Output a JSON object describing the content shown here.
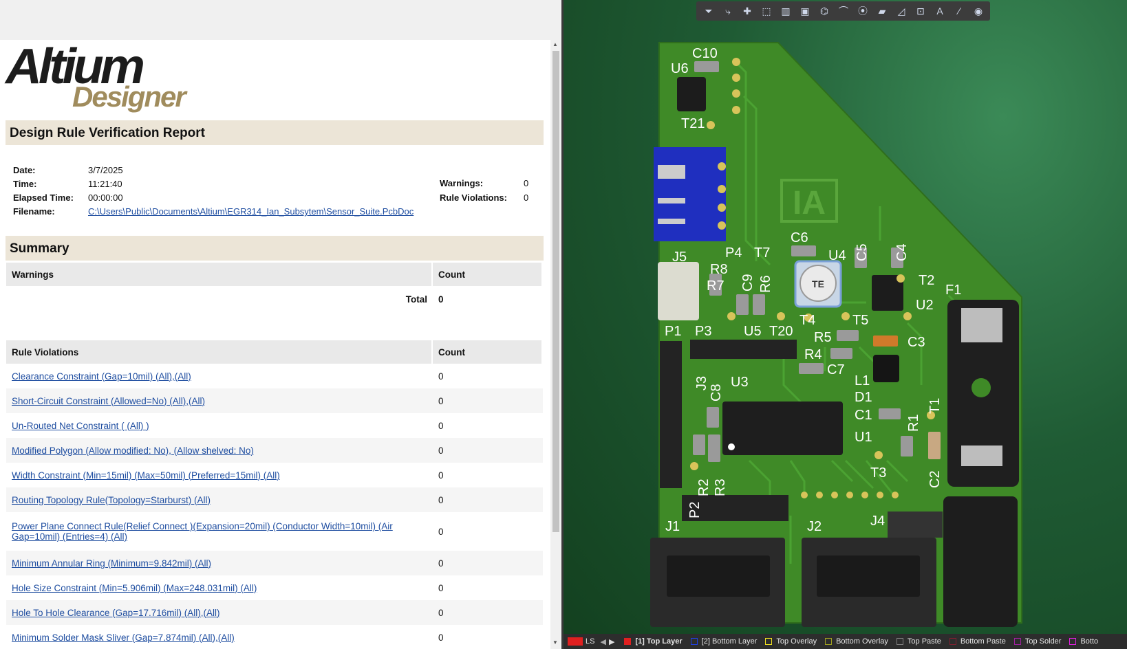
{
  "report": {
    "logo": {
      "primary": "Altium",
      "secondary": "Designer"
    },
    "title": "Design Rule Verification Report",
    "meta": {
      "date_label": "Date:",
      "date": "3/7/2025",
      "time_label": "Time:",
      "time": "11:21:40",
      "elapsed_label": "Elapsed Time:",
      "elapsed": "00:00:00",
      "filename_label": "Filename:",
      "filename": "C:\\Users\\Public\\Documents\\Altium\\EGR314_Ian_Subsytem\\Sensor_Suite.PcbDoc",
      "warnings_label": "Warnings:",
      "warnings": "0",
      "violations_label": "Rule Violations:",
      "violations": "0"
    },
    "summary_title": "Summary",
    "warnings_table": {
      "col1": "Warnings",
      "col2": "Count",
      "total_label": "Total",
      "total": "0"
    },
    "rules_table": {
      "col1": "Rule Violations",
      "col2": "Count",
      "rows": [
        {
          "name": "Clearance Constraint (Gap=10mil) (All),(All)",
          "count": "0"
        },
        {
          "name": "Short-Circuit Constraint (Allowed=No) (All),(All)",
          "count": "0"
        },
        {
          "name": "Un-Routed Net Constraint ( (All) )",
          "count": "0"
        },
        {
          "name": "Modified Polygon (Allow modified: No), (Allow shelved: No)",
          "count": "0"
        },
        {
          "name": "Width Constraint (Min=15mil) (Max=50mil) (Preferred=15mil) (All)",
          "count": "0"
        },
        {
          "name": "Routing Topology Rule(Topology=Starburst) (All)",
          "count": "0"
        },
        {
          "name": "Power Plane Connect Rule(Relief Connect )(Expansion=20mil) (Conductor Width=10mil) (Air Gap=10mil) (Entries=4) (All)",
          "count": "0"
        },
        {
          "name": "Minimum Annular Ring (Minimum=9.842mil) (All)",
          "count": "0"
        },
        {
          "name": "Hole Size Constraint (Min=5.906mil) (Max=248.031mil) (All)",
          "count": "0"
        },
        {
          "name": "Hole To Hole Clearance (Gap=17.716mil) (All),(All)",
          "count": "0"
        },
        {
          "name": "Minimum Solder Mask Sliver (Gap=7.874mil) (All),(All)",
          "count": "0"
        }
      ]
    }
  },
  "pcb": {
    "silkscreen_logo": "IA",
    "chip_marking": "TE",
    "designators": [
      "C10",
      "U6",
      "T21",
      "J5",
      "P4",
      "T7",
      "C6",
      "U4",
      "C5",
      "C4",
      "R8",
      "R7",
      "C9",
      "R6",
      "T2",
      "F1",
      "U2",
      "T4",
      "T5",
      "P1",
      "P3",
      "U5",
      "T20",
      "R5",
      "C3",
      "R4",
      "C7",
      "J3",
      "C8",
      "U3",
      "L1",
      "D1",
      "T1",
      "C1",
      "U1",
      "R1",
      "R2",
      "R3",
      "T3",
      "C2",
      "P2",
      "J1",
      "J2",
      "J4"
    ],
    "toolbar_icons": [
      "filter-icon",
      "route-icon",
      "add-icon",
      "select-rect-icon",
      "bar-chart-icon",
      "component-icon",
      "polygon-icon",
      "arc-icon",
      "via-icon",
      "fill-icon",
      "region-icon",
      "dimension-icon",
      "text-icon",
      "line-icon",
      "3d-view-icon"
    ],
    "layer_bar": {
      "ls_label": "LS",
      "layers": [
        {
          "label": "[1] Top Layer",
          "color": "#e02020",
          "active": true
        },
        {
          "label": "[2] Bottom Layer",
          "color": "#2040e0"
        },
        {
          "label": "Top Overlay",
          "color": "#f0e020"
        },
        {
          "label": "Bottom Overlay",
          "color": "#a0a020"
        },
        {
          "label": "Top Paste",
          "color": "#808080"
        },
        {
          "label": "Bottom Paste",
          "color": "#802030"
        },
        {
          "label": "Top Solder",
          "color": "#a020a0"
        },
        {
          "label": "Botto",
          "color": "#e020e0"
        }
      ]
    }
  }
}
